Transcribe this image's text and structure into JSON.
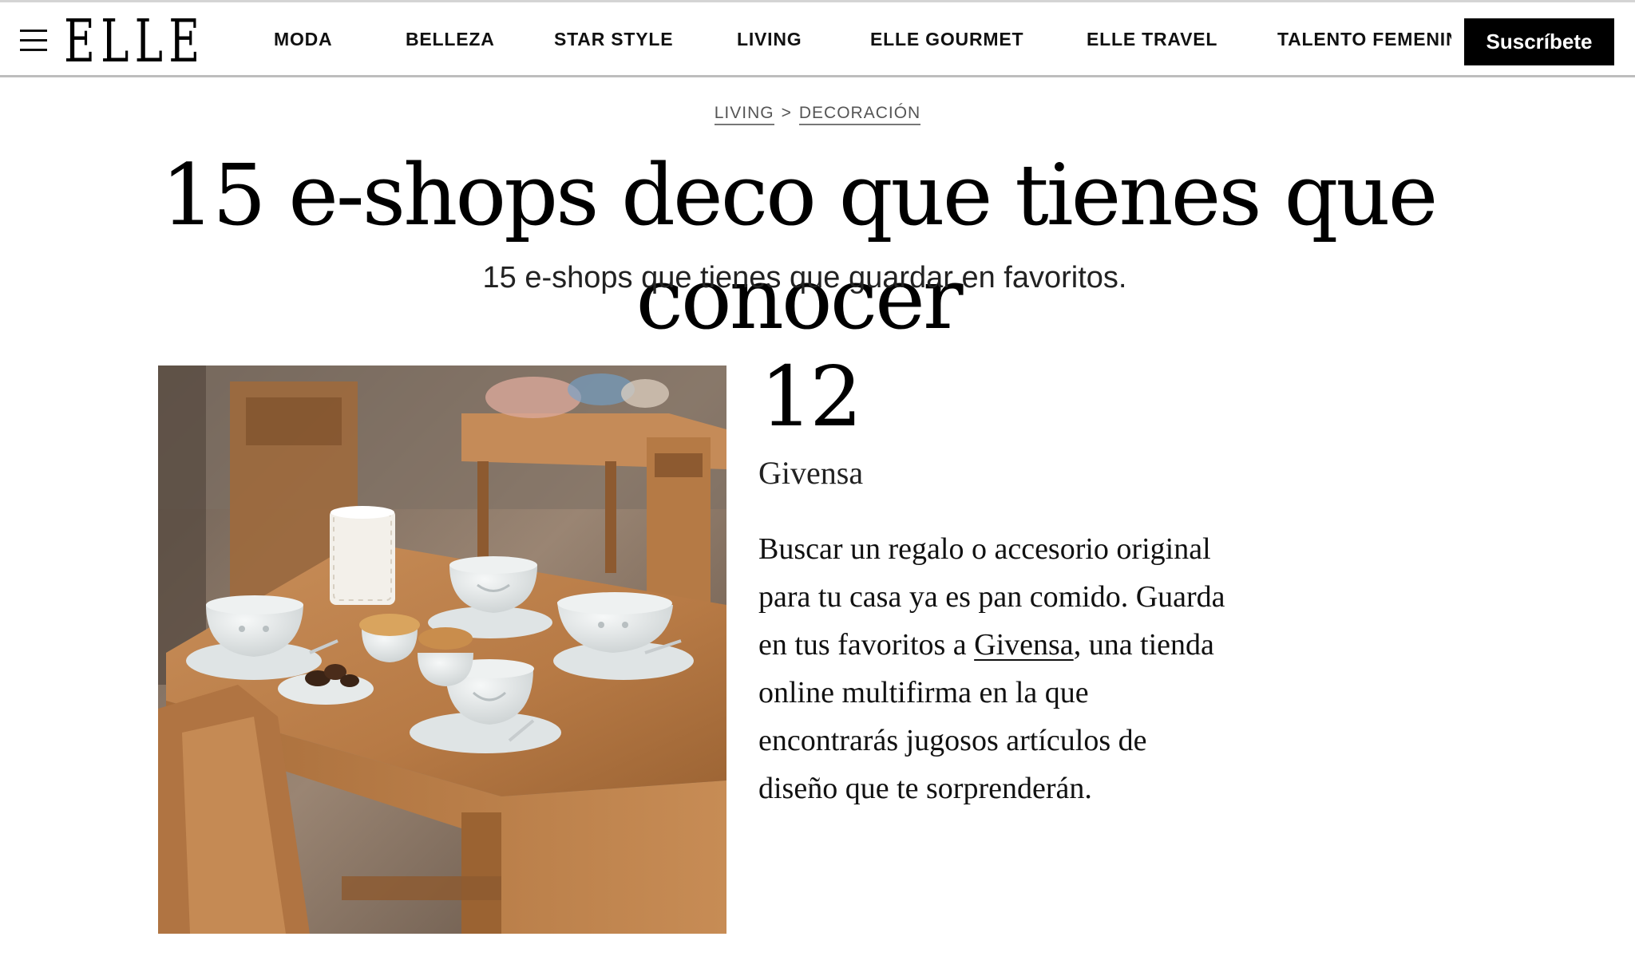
{
  "header": {
    "logo": "ELLE",
    "menu_icon": "hamburger-menu-icon",
    "nav": [
      "MODA",
      "BELLEZA",
      "STAR STYLE",
      "LIVING",
      "ELLE GOURMET",
      "ELLE TRAVEL",
      "TALENTO FEMENINO"
    ],
    "subscribe_label": "Suscríbete"
  },
  "breadcrumb": {
    "section": "LIVING",
    "separator": ">",
    "subsection": "DECORACIÓN"
  },
  "article": {
    "title": "15 e-shops deco que tienes que conocer",
    "subtitle": "15 e-shops que tienes que guardar en favoritos."
  },
  "item": {
    "number": "12",
    "name": "Givensa",
    "body_lines": [
      "Buscar un regalo o accesorio original",
      "para tu casa ya es pan comido. Guarda",
      "en tus favoritos a ",
      "online multifirma en la que",
      "encontrarás jugosos artículos de",
      "diseño que te sorprenderán."
    ],
    "link_text": "Givensa",
    "after_link": ", una tienda"
  },
  "colors": {
    "text": "#111111",
    "subscribe_bg": "#000000",
    "subscribe_text": "#ffffff",
    "breadcrumb": "#555555",
    "table_wood": "#b57a45",
    "cups": "#e9ecec"
  }
}
